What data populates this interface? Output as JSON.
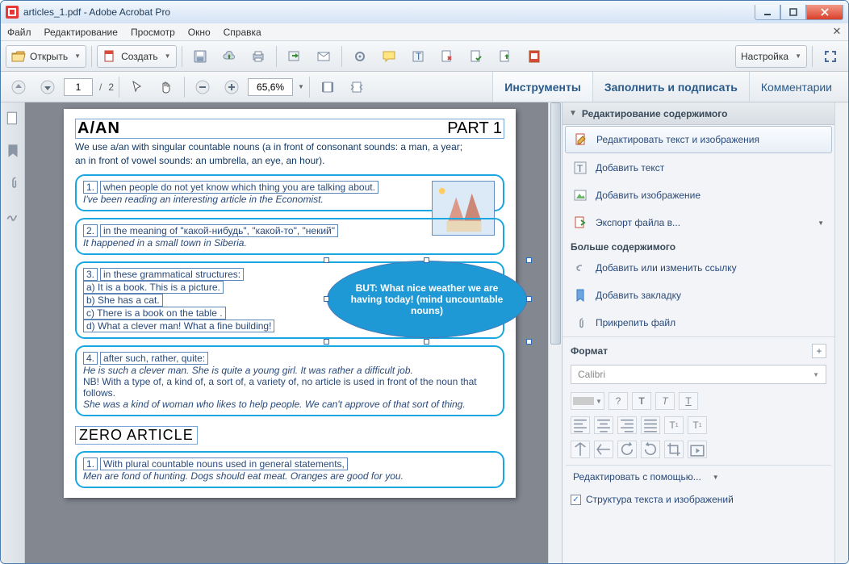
{
  "window": {
    "title": "articles_1.pdf - Adobe Acrobat Pro"
  },
  "menu": {
    "file": "Файл",
    "edit": "Редактирование",
    "view": "Просмотр",
    "window": "Окно",
    "help": "Справка"
  },
  "toolbar": {
    "open": "Открыть",
    "create": "Создать",
    "customize": "Настройка"
  },
  "nav": {
    "page": "1",
    "pages": "2",
    "zoom": "65,6%"
  },
  "tabs": {
    "tools": "Инструменты",
    "fill": "Заполнить и подписать",
    "comments": "Комментарии"
  },
  "pane": {
    "header": "Редактирование содержимого",
    "items": {
      "editTextImg": "Редактировать текст и изображения",
      "addText": "Добавить текст",
      "addImage": "Добавить изображение",
      "export": "Экспорт файла в..."
    },
    "more": "Больше содержимого",
    "moreItems": {
      "link": "Добавить или изменить ссылку",
      "bookmark": "Добавить закладку",
      "attach": "Прикрепить файл"
    },
    "format": "Формат",
    "font": "Calibri",
    "editWith": "Редактировать с помощью...",
    "structure": "Структура текста и изображений"
  },
  "doc": {
    "h1": "A/AN",
    "part": "PART 1",
    "intro1": "We use a/an with singular countable nouns (a in front of consonant sounds: a man, a year;",
    "intro2": "an in front of vowel sounds: an umbrella, an eye, an hour).",
    "b1_num": "1.",
    "b1_line": "when people do not yet know which thing you are talking about.",
    "b1_ex": "I've been reading an interesting article in the Economist.",
    "b2_num": "2.",
    "b2_line": "in the meaning of \"какой-нибудь\", \"какой-то\", \"некий\"",
    "b2_ex": "It happened in a small town in Siberia.",
    "b3_num": "3.",
    "b3_line": "in these grammatical structures:",
    "b3_a": "a) It is a book. This is a picture.",
    "b3_b": "b) She has a cat.",
    "b3_c": "c) There is a book on the table .",
    "b3_d": "d) What a clever man! What a fine building!",
    "ellipse": "BUT: What nice weather we are having today! (mind uncountable nouns)",
    "b4_num": "4.",
    "b4_line": "after such, rather, quite:",
    "b4_ex1": "He is such a clever man.   She is quite a young girl.   It was rather a difficult job.",
    "b4_ex2": "NB! With a type of, a kind of, a sort of, a variety of, no article is used in front of the noun that follows.",
    "b4_ex3": "She was a kind of woman who likes to help people.    We can't approve of that sort of thing.",
    "zero": "ZERO ARTICLE",
    "z1_num": "1.",
    "z1_line": "With plural countable nouns used in general statements,",
    "z1_ex": "Men are fond of hunting.       Dogs should eat meat.       Oranges are good for you."
  }
}
